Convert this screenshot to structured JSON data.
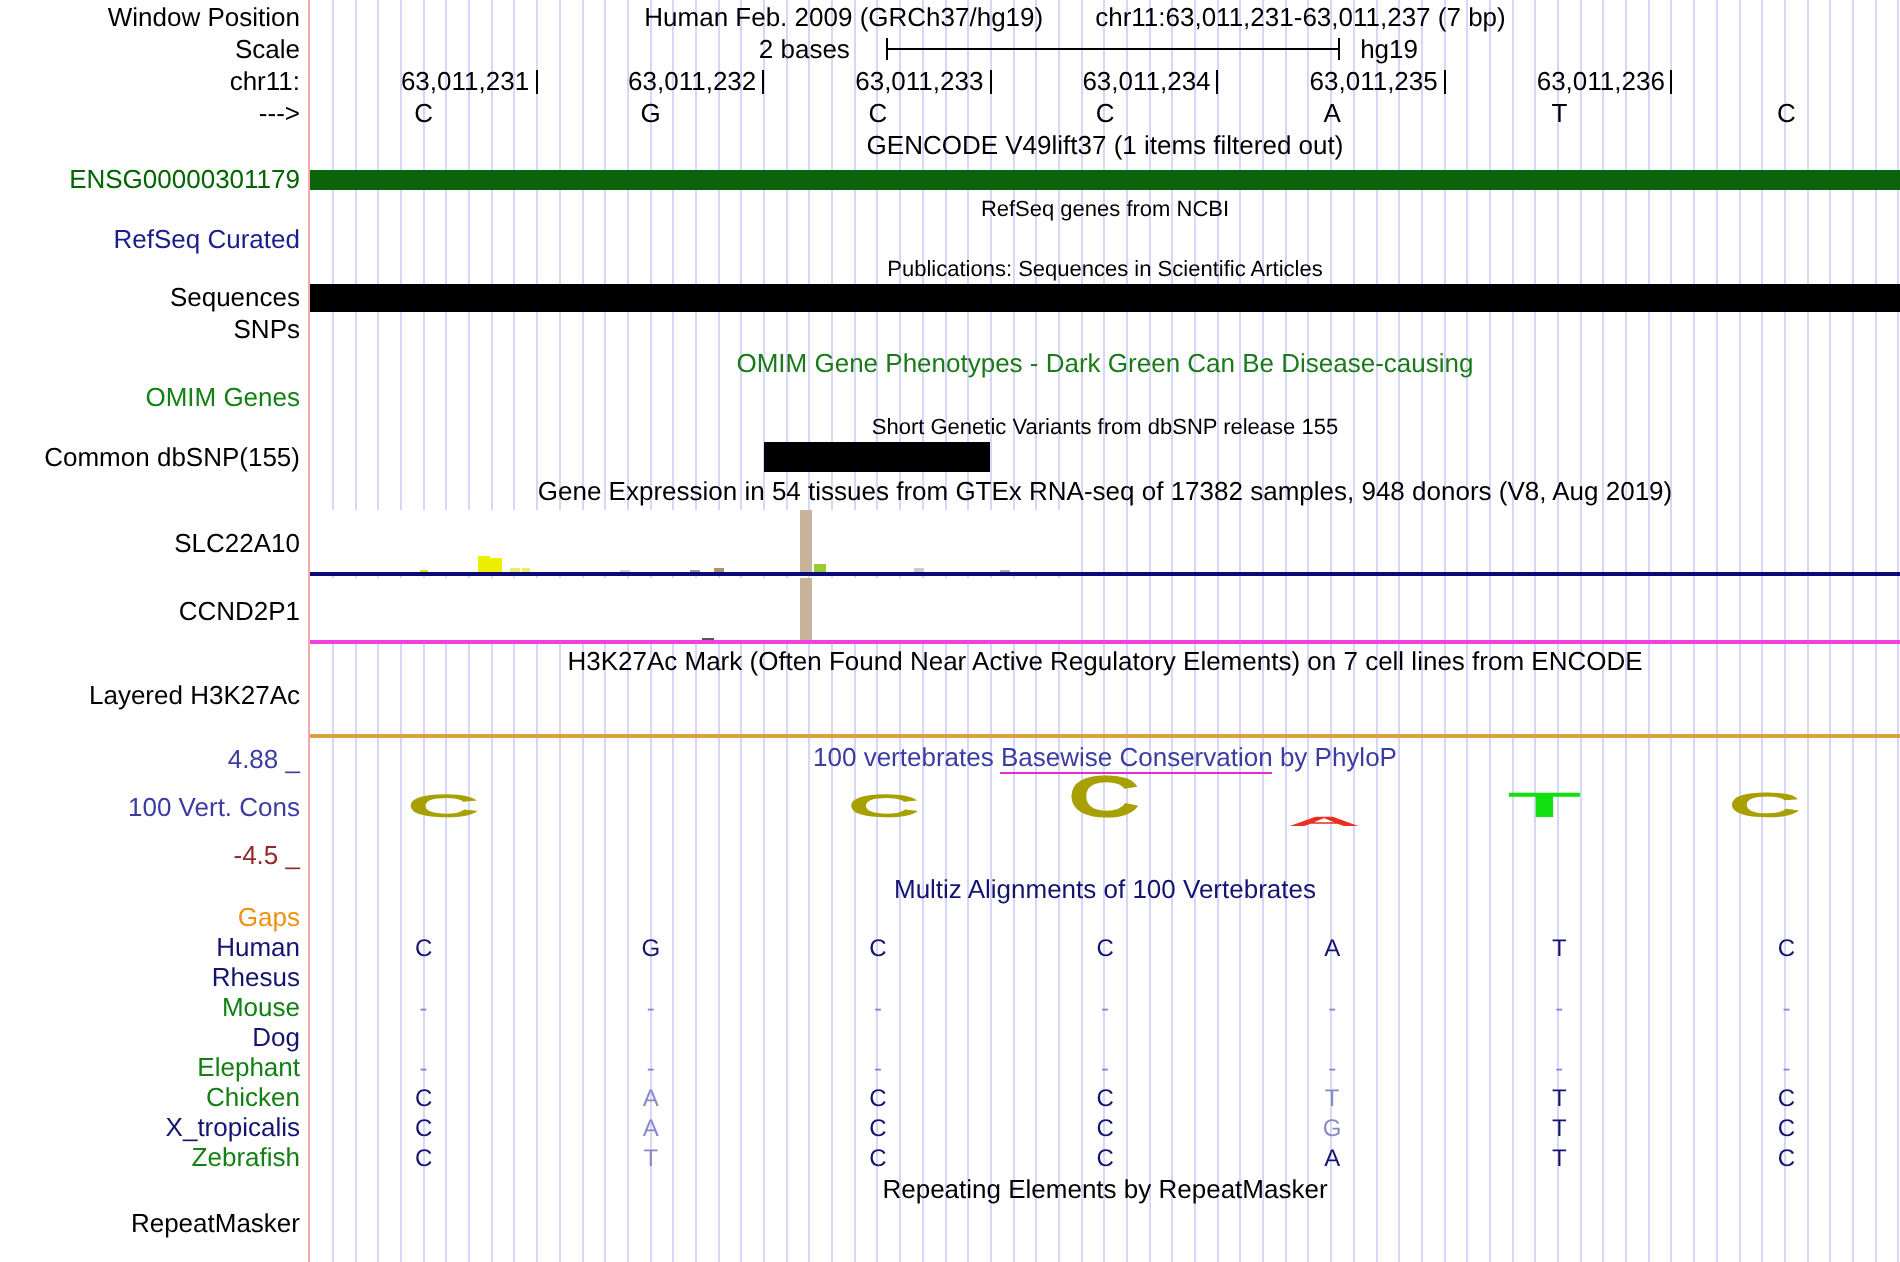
{
  "header": {
    "window_position": {
      "label": "Window Position",
      "assembly": "Human Feb. 2009 (GRCh37/hg19)",
      "position": "chr11:63,011,231-63,011,237 (7 bp)"
    },
    "scale": {
      "label": "Scale",
      "bar_label": "2 bases",
      "assembly": "hg19"
    },
    "ruler": {
      "label": "chr11:",
      "ticks": [
        "63,011,231",
        "63,011,232",
        "63,011,233",
        "63,011,234",
        "63,011,235",
        "63,011,236"
      ]
    },
    "strand": {
      "label": "--->",
      "bases": [
        "C",
        "G",
        "C",
        "C",
        "A",
        "T",
        "C"
      ]
    }
  },
  "tracks": [
    {
      "kind": "gene",
      "title": "GENCODE V49lift37 (1 items filtered out)",
      "rows": [
        {
          "label": "ENSG00000301179",
          "color": "#006400"
        }
      ]
    },
    {
      "kind": "empty",
      "title": "RefSeq genes from NCBI",
      "minor": true,
      "rows": [
        {
          "label": "RefSeq Curated",
          "color": "#1c1c8c"
        }
      ]
    },
    {
      "kind": "bar",
      "title": "Publications: Sequences in Scientific Articles",
      "minor": true,
      "rows": [
        {
          "label": "Sequences",
          "color": "#000000"
        }
      ]
    },
    {
      "kind": "empty",
      "rows": [
        {
          "label": "SNPs",
          "color": "#000000"
        }
      ]
    },
    {
      "kind": "empty",
      "title": "OMIM Gene Phenotypes - Dark Green Can Be Disease-causing",
      "rows": [
        {
          "label": "OMIM Genes",
          "color": "#138013"
        }
      ]
    },
    {
      "kind": "variant",
      "title": "Short Genetic Variants from dbSNP release 155",
      "minor": true,
      "rows": [
        {
          "label": "Common dbSNP(155)",
          "color": "#000000"
        }
      ]
    },
    {
      "kind": "expression",
      "title": "Gene Expression in 54 tissues from GTEx RNA-seq of 17382 samples, 948 donors (V8, Aug 2019)",
      "rows": [
        {
          "label": "SLC22A10",
          "color": "#000000"
        },
        {
          "label": "CCND2P1",
          "color": "#000000"
        }
      ]
    },
    {
      "kind": "signal",
      "title": "H3K27Ac Mark (Often Found Near Active Regulatory Elements) on 7 cell lines from ENCODE",
      "rows": [
        {
          "label": "Layered H3K27Ac",
          "color": "#000000"
        }
      ]
    },
    {
      "kind": "conservation",
      "title_before": "100 vertebrates ",
      "title_link": "Basewise Conservation",
      "title_after": " by PhyloP",
      "labels": [
        {
          "label": "4.88 _",
          "color": "#3c3ca0"
        },
        {
          "label": "100 Vert. Cons",
          "color": "#3c3ca0"
        },
        {
          "label": "-4.5 _",
          "color": "#902828"
        }
      ],
      "logo": [
        {
          "letter": "C",
          "color": "#a8a000"
        },
        {
          "letter": "C",
          "color": "#a8a000"
        },
        {
          "letter": "C",
          "color": "#a8a000"
        },
        {
          "letter": "A",
          "color": "#e83020"
        },
        {
          "letter": "T",
          "color": "#10e010"
        },
        {
          "letter": "C",
          "color": "#a8a000"
        }
      ]
    },
    {
      "kind": "alignment",
      "title": "Multiz Alignments of 100 Vertebrates",
      "rows": [
        {
          "label": "Gaps",
          "color": "#f09010"
        },
        {
          "label": "Human",
          "color": "#141470",
          "bases": [
            {
              "base": "C",
              "dim": false
            },
            {
              "base": "G",
              "dim": false
            },
            {
              "base": "C",
              "dim": false
            },
            {
              "base": "C",
              "dim": false
            },
            {
              "base": "A",
              "dim": false
            },
            {
              "base": "T",
              "dim": false
            },
            {
              "base": "C",
              "dim": false
            }
          ]
        },
        {
          "label": "Rhesus",
          "color": "#141470"
        },
        {
          "label": "Mouse",
          "color": "#138013",
          "bases": [
            {
              "base": "-",
              "dim": true
            },
            {
              "base": "-",
              "dim": true
            },
            {
              "base": "-",
              "dim": true
            },
            {
              "base": "-",
              "dim": true
            },
            {
              "base": "-",
              "dim": true
            },
            {
              "base": "-",
              "dim": true
            },
            {
              "base": "-",
              "dim": true
            }
          ]
        },
        {
          "label": "Dog",
          "color": "#141470"
        },
        {
          "label": "Elephant",
          "color": "#138013",
          "bases": [
            {
              "base": "-",
              "dim": true
            },
            {
              "base": "-",
              "dim": true
            },
            {
              "base": "-",
              "dim": true
            },
            {
              "base": "-",
              "dim": true
            },
            {
              "base": "-",
              "dim": true
            },
            {
              "base": "-",
              "dim": true
            },
            {
              "base": "-",
              "dim": true
            }
          ]
        },
        {
          "label": "Chicken",
          "color": "#138013",
          "bases": [
            {
              "base": "C",
              "dim": false
            },
            {
              "base": "A",
              "dim": true
            },
            {
              "base": "C",
              "dim": false
            },
            {
              "base": "C",
              "dim": false
            },
            {
              "base": "T",
              "dim": true
            },
            {
              "base": "T",
              "dim": false
            },
            {
              "base": "C",
              "dim": false
            }
          ]
        },
        {
          "label": "X_tropicalis",
          "color": "#141470",
          "bases": [
            {
              "base": "C",
              "dim": false
            },
            {
              "base": "A",
              "dim": true
            },
            {
              "base": "C",
              "dim": false
            },
            {
              "base": "C",
              "dim": false
            },
            {
              "base": "G",
              "dim": true
            },
            {
              "base": "T",
              "dim": false
            },
            {
              "base": "C",
              "dim": false
            }
          ]
        },
        {
          "label": "Zebrafish",
          "color": "#138013",
          "bases": [
            {
              "base": "C",
              "dim": false
            },
            {
              "base": "T",
              "dim": true
            },
            {
              "base": "C",
              "dim": false
            },
            {
              "base": "C",
              "dim": false
            },
            {
              "base": "A",
              "dim": false
            },
            {
              "base": "T",
              "dim": false
            },
            {
              "base": "C",
              "dim": false
            }
          ]
        }
      ]
    },
    {
      "kind": "empty",
      "title": "Repeating Elements by RepeatMasker",
      "rows": [
        {
          "label": "RepeatMasker",
          "color": "#000000"
        }
      ]
    }
  ]
}
